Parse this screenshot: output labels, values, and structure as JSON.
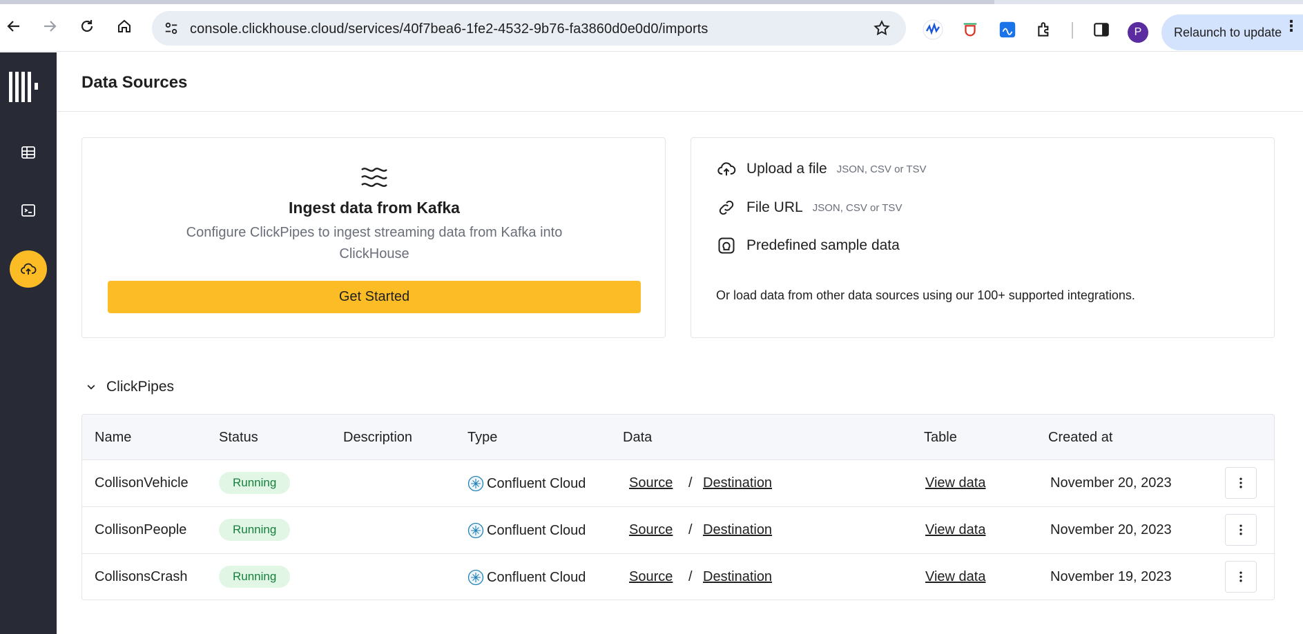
{
  "browser": {
    "url": "console.clickhouse.cloud/services/40f7bea6-1fe2-4532-9b76-fa3860d0e0d0/imports",
    "relaunch_label": "Relaunch to update",
    "profile_initial": "P"
  },
  "sidebar": {
    "items": [
      {
        "name": "tables",
        "icon": "table-icon"
      },
      {
        "name": "sql-console",
        "icon": "terminal-icon"
      },
      {
        "name": "imports",
        "icon": "cloud-upload-icon",
        "active": true
      }
    ]
  },
  "page": {
    "title": "Data Sources"
  },
  "kafka_card": {
    "title": "Ingest data from Kafka",
    "description": "Configure ClickPipes to ingest streaming data from Kafka into ClickHouse",
    "button_label": "Get Started"
  },
  "upload_card": {
    "options": [
      {
        "label": "Upload a file",
        "hint": "JSON, CSV or TSV",
        "icon": "cloud-upload-icon"
      },
      {
        "label": "File URL",
        "hint": "JSON, CSV or TSV",
        "icon": "link-icon"
      },
      {
        "label": "Predefined sample data",
        "hint": "",
        "icon": "sample-data-icon"
      }
    ],
    "note": "Or load data from other data sources using our 100+ supported integrations."
  },
  "clickpipes": {
    "section_label": "ClickPipes",
    "columns": [
      "Name",
      "Status",
      "Description",
      "Type",
      "Data",
      "Table",
      "Created at"
    ],
    "rows": [
      {
        "name": "CollisonVehicle",
        "status": "Running",
        "description": "",
        "type": "Confluent Cloud",
        "source": "Source",
        "separator": "/",
        "destination": "Destination",
        "table": "View data",
        "created": "November 20, 2023"
      },
      {
        "name": "CollisonPeople",
        "status": "Running",
        "description": "",
        "type": "Confluent Cloud",
        "source": "Source",
        "separator": "/",
        "destination": "Destination",
        "table": "View data",
        "created": "November 20, 2023"
      },
      {
        "name": "CollisonsCrash",
        "status": "Running",
        "description": "",
        "type": "Confluent Cloud",
        "source": "Source",
        "separator": "/",
        "destination": "Destination",
        "table": "View data",
        "created": "November 19, 2023"
      }
    ]
  },
  "colors": {
    "accent": "#fbbc26",
    "sidebar_bg": "#282a36",
    "status_running_bg": "#e1f6e5",
    "status_running_text": "#15803d"
  }
}
